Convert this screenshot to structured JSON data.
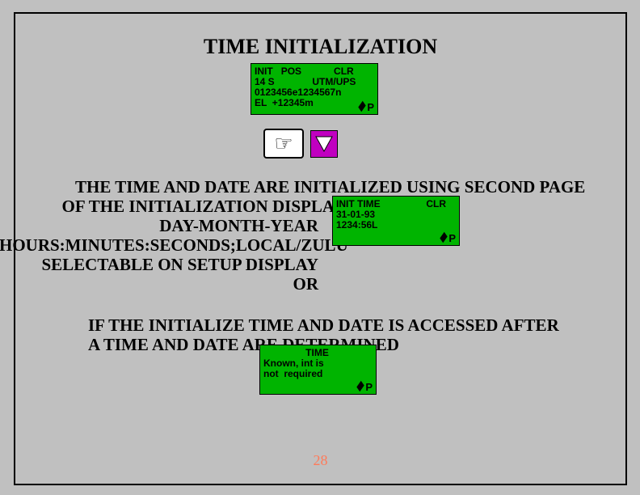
{
  "title": "TIME INITIALIZATION",
  "display1": {
    "r1_left": "INIT",
    "r1_mid": "POS",
    "r1_right": "CLR",
    "r2_left": "14 S",
    "r2_right": "UTM/UPS",
    "r3": "0123456e1234567n",
    "r4": "EL  +12345m",
    "p": "P"
  },
  "para1": {
    "l1": "THE TIME AND DATE ARE INITIALIZED USING SECOND PAGE",
    "l2": "OF THE INITIALIZATION DISPLA",
    "l3": "DAY-MONTH-YEAR",
    "l4": "HOURS:MINUTES:SECONDS;LOCAL/ZULU",
    "l5": "SELECTABLE ON SETUP DISPLAY",
    "l6": "OR"
  },
  "display2": {
    "r1_left": "INIT TIME",
    "r1_right": "CLR",
    "r2": "31-01-93",
    "r3": "1234:56L",
    "p": "P"
  },
  "para2": {
    "l1": "IF THE INITIALIZE TIME AND DATE IS ACCESSED AFTER",
    "l2": "A TIME AND DATE ARE DETERMINED"
  },
  "display3": {
    "r1": "TIME",
    "r2": "Known, int is",
    "r3": "not  required",
    "p": "P"
  },
  "page": "28"
}
